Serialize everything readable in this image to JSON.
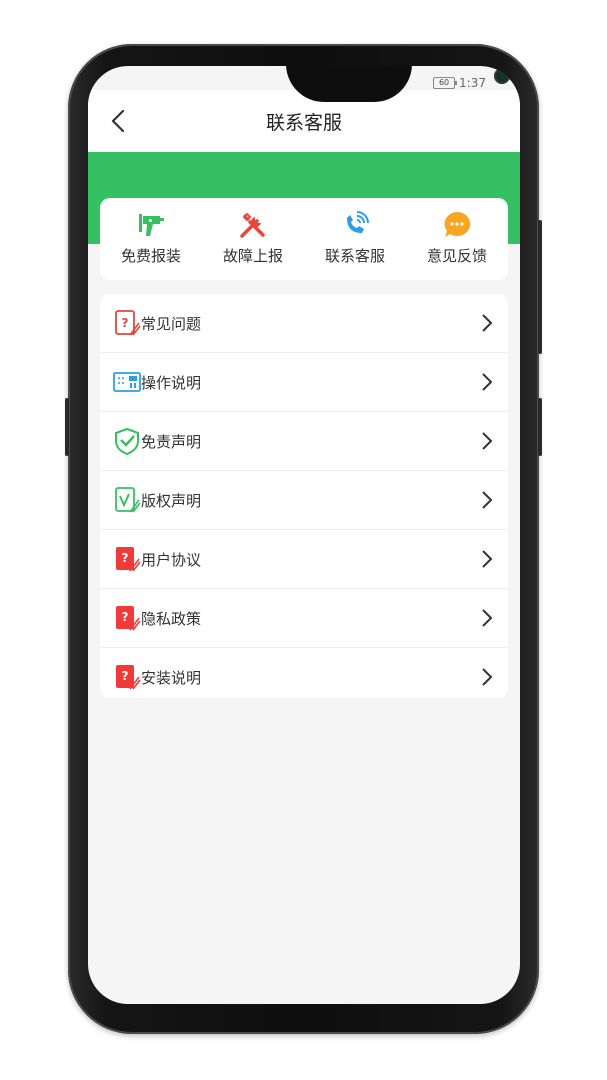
{
  "status_bar": {
    "battery": "60",
    "time": "1:37"
  },
  "header": {
    "title": "联系客服"
  },
  "quick_actions": [
    {
      "label": "免费报装",
      "icon": "drill-icon",
      "color": "#35c163"
    },
    {
      "label": "故障上报",
      "icon": "tools-icon",
      "color": "#e8463b"
    },
    {
      "label": "联系客服",
      "icon": "phone-icon",
      "color": "#2a9fe6"
    },
    {
      "label": "意见反馈",
      "icon": "chat-bubble-icon",
      "color": "#f6a623"
    }
  ],
  "menu": [
    {
      "label": "常见问题",
      "icon": "question-card-outline-icon"
    },
    {
      "label": "操作说明",
      "icon": "device-manual-icon"
    },
    {
      "label": "免责声明",
      "icon": "shield-check-icon"
    },
    {
      "label": "版权声明",
      "icon": "check-card-icon"
    },
    {
      "label": "用户协议",
      "icon": "question-card-red-icon"
    },
    {
      "label": "隐私政策",
      "icon": "question-card-red-icon"
    },
    {
      "label": "安装说明",
      "icon": "question-card-red-icon"
    }
  ],
  "colors": {
    "brand_green": "#35c163",
    "background": "#f5f5f5"
  }
}
